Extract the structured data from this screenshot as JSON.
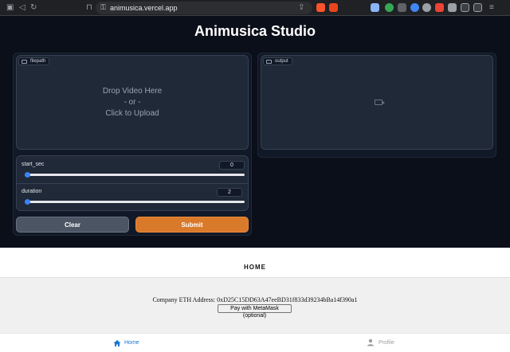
{
  "browser": {
    "url": "animusica.vercel.app",
    "nav_back": "◁",
    "nav_forward": "▷",
    "reload": "↻",
    "bookmark": "⊓",
    "lock": "🔒"
  },
  "app": {
    "title": "Animusica Studio",
    "input": {
      "label": "filepath",
      "drop_line1": "Drop Video Here",
      "drop_line2": "- or -",
      "drop_line3": "Click to Upload"
    },
    "output": {
      "label": "output"
    },
    "sliders": [
      {
        "label": "start_sec",
        "value": "0",
        "fraction": 0
      },
      {
        "label": "duration",
        "value": "2",
        "fraction": 0
      }
    ],
    "clear_label": "Clear",
    "submit_label": "Submit"
  },
  "lower": {
    "header": "HOME",
    "eth_text": "Company ETH Address: 0xD25C15DD63A47eeBD31f833d39234bBa14f390a1",
    "metamask_label": "Pay with MetaMask (optional)",
    "nav": [
      {
        "label": "Home",
        "icon": "home-icon",
        "active": true
      },
      {
        "label": "Profile",
        "icon": "profile-icon",
        "active": false
      }
    ]
  },
  "colors": {
    "accent_submit": "#d97a2b",
    "slider_thumb": "#3b82f6",
    "nav_active": "#1976d2",
    "nav_inactive": "#9e9e9e"
  }
}
